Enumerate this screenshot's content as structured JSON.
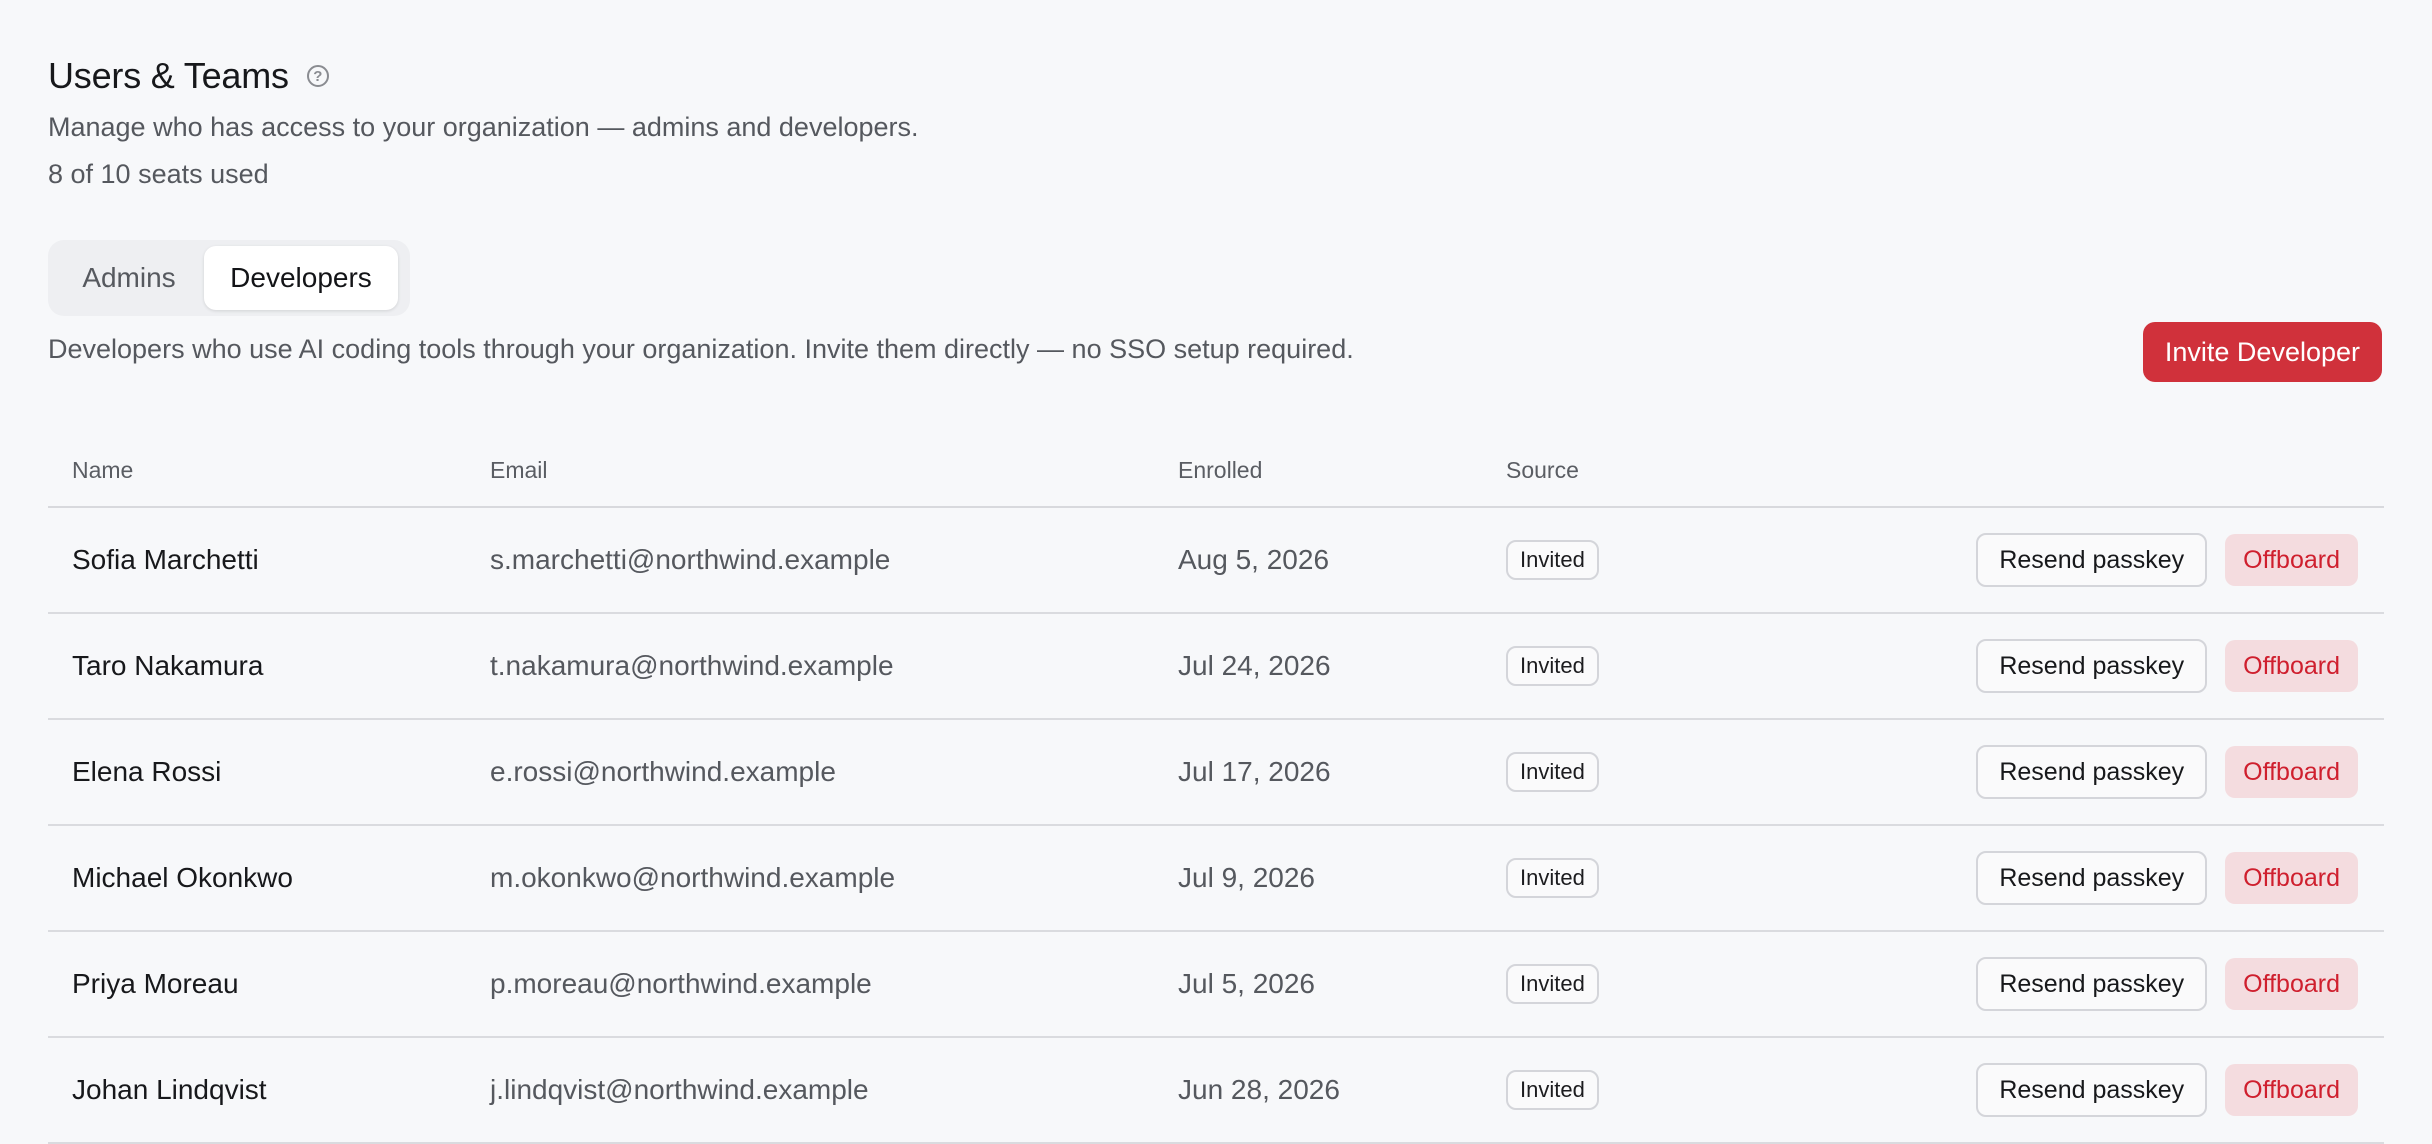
{
  "header": {
    "title": "Users & Teams",
    "help_icon": "?",
    "subtitle": "Manage who has access to your organization — admins and developers.",
    "seats": "8 of 10 seats used"
  },
  "tabs": [
    {
      "label": "Admins",
      "active": false
    },
    {
      "label": "Developers",
      "active": true
    }
  ],
  "developers": {
    "description": "Developers who use AI coding tools through your organization. Invite them directly — no SSO setup required.",
    "invite_label": "Invite Developer",
    "columns": {
      "name": "Name",
      "email": "Email",
      "enrolled": "Enrolled",
      "source": "Source"
    },
    "rows": [
      {
        "name": "Sofia Marchetti",
        "email": "s.marchetti@northwind.example",
        "enrolled": "Aug 5, 2026",
        "source": "Invited",
        "resend": "Resend passkey",
        "offboard": "Offboard"
      },
      {
        "name": "Taro Nakamura",
        "email": "t.nakamura@northwind.example",
        "enrolled": "Jul 24, 2026",
        "source": "Invited",
        "resend": "Resend passkey",
        "offboard": "Offboard"
      },
      {
        "name": "Elena Rossi",
        "email": "e.rossi@northwind.example",
        "enrolled": "Jul 17, 2026",
        "source": "Invited",
        "resend": "Resend passkey",
        "offboard": "Offboard"
      },
      {
        "name": "Michael Okonkwo",
        "email": "m.okonkwo@northwind.example",
        "enrolled": "Jul 9, 2026",
        "source": "Invited",
        "resend": "Resend passkey",
        "offboard": "Offboard"
      },
      {
        "name": "Priya Moreau",
        "email": "p.moreau@northwind.example",
        "enrolled": "Jul 5, 2026",
        "source": "Invited",
        "resend": "Resend passkey",
        "offboard": "Offboard"
      },
      {
        "name": "Johan Lindqvist",
        "email": "j.lindqvist@northwind.example",
        "enrolled": "Jun 28, 2026",
        "source": "Invited",
        "resend": "Resend passkey",
        "offboard": "Offboard"
      }
    ]
  },
  "colors": {
    "background": "#f7f8fa",
    "primary_button": "#d0313b",
    "danger_text": "#cf1f2e",
    "danger_bg": "#f4dcdf"
  }
}
